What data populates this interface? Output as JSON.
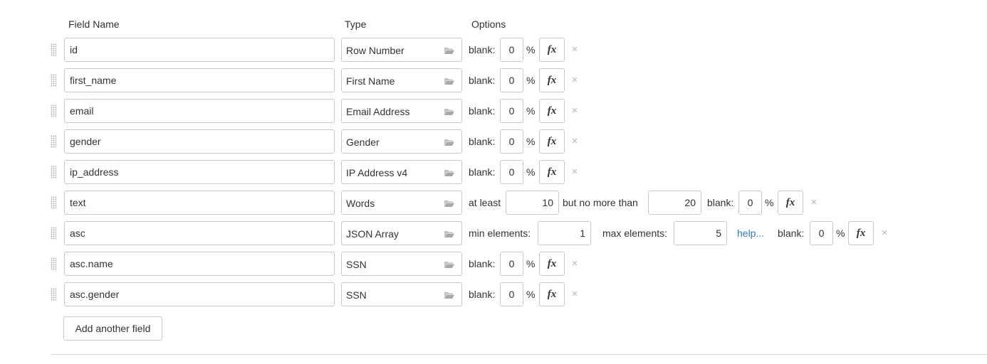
{
  "header": {
    "field_name": "Field Name",
    "type": "Type",
    "options": "Options"
  },
  "labels": {
    "blank": "blank:",
    "percent": "%",
    "fx": "fx",
    "remove": "×",
    "at_least": "at least",
    "but_no_more_than": "but no more than",
    "min_elements": "min elements:",
    "max_elements": "max elements:",
    "help": "help..."
  },
  "rows": [
    {
      "name": "id",
      "type": "Row Number",
      "blank": "0"
    },
    {
      "name": "first_name",
      "type": "First Name",
      "blank": "0"
    },
    {
      "name": "email",
      "type": "Email Address",
      "blank": "0"
    },
    {
      "name": "gender",
      "type": "Gender",
      "blank": "0"
    },
    {
      "name": "ip_address",
      "type": "IP Address v4",
      "blank": "0"
    },
    {
      "name": "text",
      "type": "Words",
      "at_least": "10",
      "no_more_than": "20",
      "blank": "0"
    },
    {
      "name": "asc",
      "type": "JSON Array",
      "min_elements": "1",
      "max_elements": "5",
      "blank": "0"
    },
    {
      "name": "asc.name",
      "type": "SSN",
      "blank": "0"
    },
    {
      "name": "asc.gender",
      "type": "SSN",
      "blank": "0"
    }
  ],
  "add_field_label": "Add another field",
  "icons": {
    "drag": "drag-handle-icon",
    "type_picker": "folder-open-icon",
    "formula": "fx-icon",
    "remove": "close-icon"
  },
  "colors": {
    "border": "#c8c8c8",
    "text": "#333333",
    "link": "#3a7ab8",
    "muted_icon": "#b8b8b8"
  }
}
